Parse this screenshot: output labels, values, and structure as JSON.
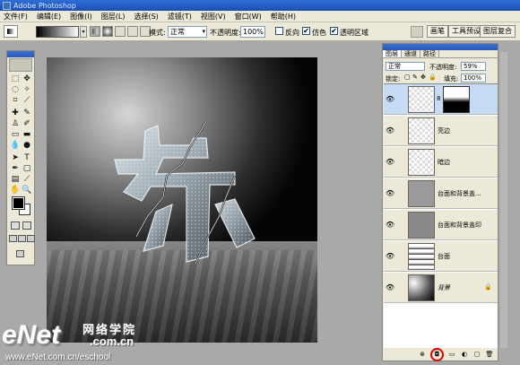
{
  "window": {
    "title": "Adobe Photoshop"
  },
  "menu": [
    "文件(F)",
    "编辑(E)",
    "图像(I)",
    "图层(L)",
    "选择(S)",
    "滤镜(T)",
    "视图(V)",
    "窗口(W)",
    "帮助(H)"
  ],
  "options": {
    "mode_label": "模式:",
    "mode_value": "正常",
    "opacity_label": "不透明度:",
    "opacity_value": "100%",
    "reverse_label": "反向",
    "dither_label": "仿色",
    "transparency_label": "透明区域",
    "dither_checked": "✔",
    "transparency_checked": "✔"
  },
  "workspace_tabs": [
    "画笔",
    "工具预设",
    "图层复合"
  ],
  "layers_panel": {
    "tabs": [
      "图层",
      "通道",
      "路径"
    ],
    "blend_mode": "正常",
    "opacity_label": "不透明度:",
    "opacity_value": "59%",
    "lock_label": "锁定:",
    "fill_label": "填充:",
    "fill_value": "100%",
    "layers": [
      {
        "name": "",
        "selected": true,
        "has_mask": true
      },
      {
        "name": "亮边",
        "selected": false
      },
      {
        "name": "暗边",
        "selected": false
      },
      {
        "name": "台面和背景盖...",
        "selected": false
      },
      {
        "name": "台面和背景盖印",
        "selected": false
      },
      {
        "name": "台面",
        "selected": false
      },
      {
        "name": "背景",
        "selected": false,
        "locked": true
      }
    ]
  },
  "watermark": {
    "logo": "eNet",
    "cn": "网络学院",
    "com": ".com.cn",
    "url": "www.eNet.com.cn/eschool"
  }
}
